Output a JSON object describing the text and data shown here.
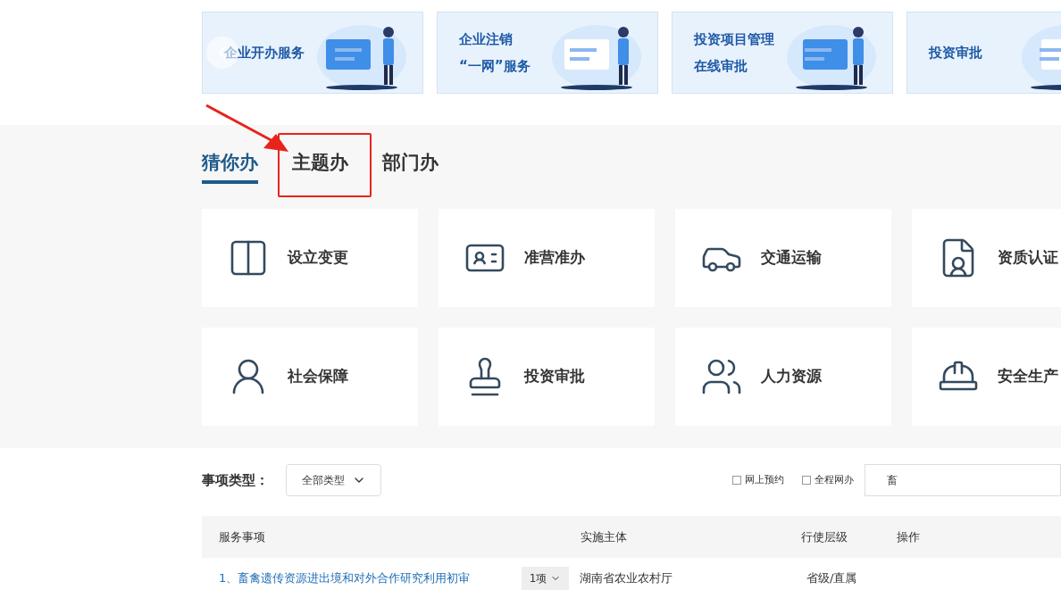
{
  "banners": [
    {
      "lines": [
        "企业开办服务"
      ]
    },
    {
      "lines": [
        "企业注销",
        "“一网”服务"
      ]
    },
    {
      "lines": [
        "投资项目管理",
        "在线审批"
      ]
    },
    {
      "lines": [
        "投资审批"
      ]
    }
  ],
  "tabs": [
    {
      "label": "猜你办",
      "selected": true
    },
    {
      "label": "主题办",
      "selected": false,
      "highlighted": true
    },
    {
      "label": "部门办",
      "selected": false
    }
  ],
  "topics": [
    {
      "label": "设立变更"
    },
    {
      "label": "准营准办"
    },
    {
      "label": "交通运输"
    },
    {
      "label": "资质认证"
    },
    {
      "label": "社会保障"
    },
    {
      "label": "投资审批"
    },
    {
      "label": "人力资源"
    },
    {
      "label": "安全生产"
    }
  ],
  "filter": {
    "label": "事项类型：",
    "type_select": "全部类型",
    "options": [
      {
        "label": "网上预约",
        "checked": false
      },
      {
        "label": "全程网办",
        "checked": false
      }
    ],
    "search": {
      "value": "畜"
    }
  },
  "table": {
    "columns": [
      "服务事项",
      "实施主体",
      "行使层级",
      "操作"
    ],
    "rows": [
      {
        "name": "1、畜禽遗传资源进出境和对外合作研究利用初审",
        "count": "1项",
        "agency": "湖南省农业农村厅",
        "level": "省级/直属"
      }
    ]
  }
}
